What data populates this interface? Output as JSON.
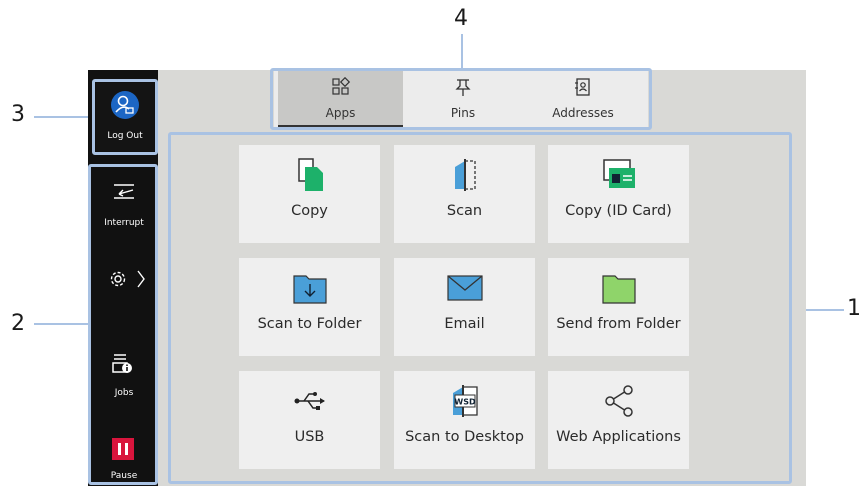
{
  "callouts": [
    "1",
    "2",
    "3",
    "4"
  ],
  "sidebar": {
    "logout_label": "Log Out",
    "interrupt_label": "Interrupt",
    "jobs_label": "Jobs",
    "pause_label": "Pause",
    "icons": [
      "user-icon",
      "interrupt-icon",
      "gear-icon",
      "jobs-icon",
      "pause-icon"
    ]
  },
  "tabs": [
    {
      "label": "Apps",
      "icon": "apps-grid-icon",
      "active": true
    },
    {
      "label": "Pins",
      "icon": "pin-icon",
      "active": false
    },
    {
      "label": "Addresses",
      "icon": "address-book-icon",
      "active": false
    }
  ],
  "apps": [
    {
      "label": "Copy",
      "icon": "copy-icon"
    },
    {
      "label": "Scan",
      "icon": "scan-icon"
    },
    {
      "label": "Copy (ID Card)",
      "icon": "id-card-icon"
    },
    {
      "label": "Scan to Folder",
      "icon": "folder-icon"
    },
    {
      "label": "Email",
      "icon": "envelope-icon"
    },
    {
      "label": "Send from Folder",
      "icon": "green-folder-icon"
    },
    {
      "label": "USB",
      "icon": "usb-icon"
    },
    {
      "label": "Scan to Desktop",
      "icon": "wsd-icon"
    },
    {
      "label": "Web Applications",
      "icon": "share-icon"
    }
  ],
  "colors": {
    "accent_blue": "#1c66c4",
    "pause_red": "#d9153d",
    "highlight": "#a9c2e3",
    "copy_green": "#1db16a",
    "scan_blue": "#4a9fd8",
    "folder_green": "#8fd46a"
  }
}
